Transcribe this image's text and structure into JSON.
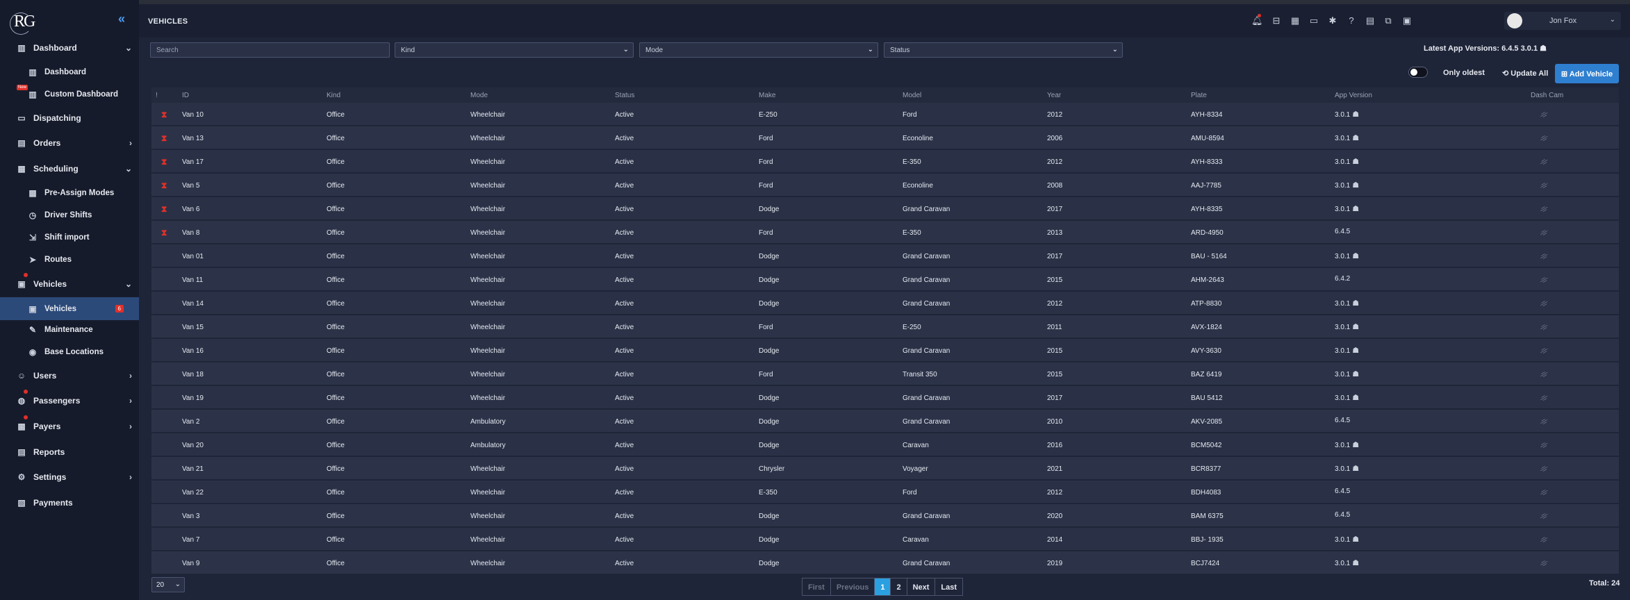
{
  "header": {
    "title": "VEHICLES",
    "user_name": "Jon Fox"
  },
  "sidebar": {
    "logo": "RG",
    "items": [
      {
        "label": "Dashboard"
      },
      {
        "label": "Dashboard"
      },
      {
        "label": "Custom Dashboard",
        "tag": "New"
      },
      {
        "label": "Dispatching"
      },
      {
        "label": "Orders"
      },
      {
        "label": "Scheduling"
      },
      {
        "label": "Pre-Assign Modes"
      },
      {
        "label": "Driver Shifts"
      },
      {
        "label": "Shift import"
      },
      {
        "label": "Routes"
      },
      {
        "label": "Vehicles"
      },
      {
        "label": "Vehicles",
        "badge": "6"
      },
      {
        "label": "Maintenance"
      },
      {
        "label": "Base Locations"
      },
      {
        "label": "Users"
      },
      {
        "label": "Passengers"
      },
      {
        "label": "Payers"
      },
      {
        "label": "Reports"
      },
      {
        "label": "Settings"
      },
      {
        "label": "Payments"
      }
    ]
  },
  "filters": {
    "search_placeholder": "Search",
    "kind": "Kind",
    "mode": "Mode",
    "status": "Status"
  },
  "latest_versions": {
    "label": "Latest App Versions: 6.4.5",
    "android": "3.0.1"
  },
  "controls": {
    "only_oldest": "Only oldest",
    "update_all": "Update All",
    "add_vehicle": "Add Vehicle"
  },
  "table": {
    "columns": [
      "!",
      "ID",
      "Kind",
      "Mode",
      "Status",
      "Make",
      "Model",
      "Year",
      "Plate",
      "App Version",
      "Dash Cam"
    ],
    "rows": [
      {
        "warn": true,
        "id": "Van 10",
        "kind": "Office",
        "mode": "Wheelchair",
        "status": "Active",
        "make": "E-250",
        "model": "Ford",
        "year": "2012",
        "plate": "AYH-8334",
        "version": "3.0.1",
        "os": "android"
      },
      {
        "warn": true,
        "id": "Van 13",
        "kind": "Office",
        "mode": "Wheelchair",
        "status": "Active",
        "make": "Ford",
        "model": "Econoline",
        "year": "2006",
        "plate": "AMU-8594",
        "version": "3.0.1",
        "os": "android"
      },
      {
        "warn": true,
        "id": "Van 17",
        "kind": "Office",
        "mode": "Wheelchair",
        "status": "Active",
        "make": "Ford",
        "model": "E-350",
        "year": "2012",
        "plate": "AYH-8333",
        "version": "3.0.1",
        "os": "android"
      },
      {
        "warn": true,
        "id": "Van 5",
        "kind": "Office",
        "mode": "Wheelchair",
        "status": "Active",
        "make": "Ford",
        "model": "Econoline",
        "year": "2008",
        "plate": "AAJ-7785",
        "version": "3.0.1",
        "os": "android"
      },
      {
        "warn": true,
        "id": "Van 6",
        "kind": "Office",
        "mode": "Wheelchair",
        "status": "Active",
        "make": "Dodge",
        "model": "Grand Caravan",
        "year": "2017",
        "plate": "AYH-8335",
        "version": "3.0.1",
        "os": "android"
      },
      {
        "warn": true,
        "id": "Van 8",
        "kind": "Office",
        "mode": "Wheelchair",
        "status": "Active",
        "make": "Ford",
        "model": "E-350",
        "year": "2013",
        "plate": "ARD-4950",
        "version": "6.4.5",
        "os": "apple"
      },
      {
        "warn": false,
        "id": "Van 01",
        "kind": "Office",
        "mode": "Wheelchair",
        "status": "Active",
        "make": "Dodge",
        "model": "Grand Caravan",
        "year": "2017",
        "plate": "BAU - 5164",
        "version": "3.0.1",
        "os": "android"
      },
      {
        "warn": false,
        "id": "Van 11",
        "kind": "Office",
        "mode": "Wheelchair",
        "status": "Active",
        "make": "Dodge",
        "model": "Grand Caravan",
        "year": "2015",
        "plate": "AHM-2643",
        "version": "6.4.2",
        "os": "apple"
      },
      {
        "warn": false,
        "id": "Van 14",
        "kind": "Office",
        "mode": "Wheelchair",
        "status": "Active",
        "make": "Dodge",
        "model": "Grand Caravan",
        "year": "2012",
        "plate": "ATP-8830",
        "version": "3.0.1",
        "os": "android"
      },
      {
        "warn": false,
        "id": "Van 15",
        "kind": "Office",
        "mode": "Wheelchair",
        "status": "Active",
        "make": "Ford",
        "model": "E-250",
        "year": "2011",
        "plate": "AVX-1824",
        "version": "3.0.1",
        "os": "android"
      },
      {
        "warn": false,
        "id": "Van 16",
        "kind": "Office",
        "mode": "Wheelchair",
        "status": "Active",
        "make": "Dodge",
        "model": "Grand Caravan",
        "year": "2015",
        "plate": "AVY-3630",
        "version": "3.0.1",
        "os": "android"
      },
      {
        "warn": false,
        "id": "Van 18",
        "kind": "Office",
        "mode": "Wheelchair",
        "status": "Active",
        "make": "Ford",
        "model": "Transit 350",
        "year": "2015",
        "plate": "BAZ 6419",
        "version": "3.0.1",
        "os": "android"
      },
      {
        "warn": false,
        "id": "Van 19",
        "kind": "Office",
        "mode": "Wheelchair",
        "status": "Active",
        "make": "Dodge",
        "model": "Grand Caravan",
        "year": "2017",
        "plate": "BAU 5412",
        "version": "3.0.1",
        "os": "android"
      },
      {
        "warn": false,
        "id": "Van 2",
        "kind": "Office",
        "mode": "Ambulatory",
        "status": "Active",
        "make": "Dodge",
        "model": "Grand Caravan",
        "year": "2010",
        "plate": "AKV-2085",
        "version": "6.4.5",
        "os": "apple"
      },
      {
        "warn": false,
        "id": "Van 20",
        "kind": "Office",
        "mode": "Ambulatory",
        "status": "Active",
        "make": "Dodge",
        "model": "Caravan",
        "year": "2016",
        "plate": "BCM5042",
        "version": "3.0.1",
        "os": "android"
      },
      {
        "warn": false,
        "id": "Van 21",
        "kind": "Office",
        "mode": "Wheelchair",
        "status": "Active",
        "make": "Chrysler",
        "model": "Voyager",
        "year": "2021",
        "plate": "BCR8377",
        "version": "3.0.1",
        "os": "android"
      },
      {
        "warn": false,
        "id": "Van 22",
        "kind": "Office",
        "mode": "Wheelchair",
        "status": "Active",
        "make": "E-350",
        "model": "Ford",
        "year": "2012",
        "plate": "BDH4083",
        "version": "6.4.5",
        "os": ""
      },
      {
        "warn": false,
        "id": "Van 3",
        "kind": "Office",
        "mode": "Wheelchair",
        "status": "Active",
        "make": "Dodge",
        "model": "Grand Caravan",
        "year": "2020",
        "plate": "BAM 6375",
        "version": "6.4.5",
        "os": "apple"
      },
      {
        "warn": false,
        "id": "Van 7",
        "kind": "Office",
        "mode": "Wheelchair",
        "status": "Active",
        "make": "Dodge",
        "model": "Caravan",
        "year": "2014",
        "plate": "BBJ- 1935",
        "version": "3.0.1",
        "os": "android"
      },
      {
        "warn": false,
        "id": "Van 9",
        "kind": "Office",
        "mode": "Wheelchair",
        "status": "Active",
        "make": "Dodge",
        "model": "Grand Caravan",
        "year": "2019",
        "plate": "BCJ7424",
        "version": "3.0.1",
        "os": "android"
      }
    ]
  },
  "pagination": {
    "per_page": "20",
    "first": "First",
    "previous": "Previous",
    "pages": [
      "1",
      "2"
    ],
    "next": "Next",
    "last": "Last",
    "total": "Total: 24"
  },
  "colors": {
    "accent": "#2f7fd0",
    "active_page": "#2aa0e0",
    "alert": "#e0302a",
    "background": "#1f2538",
    "sidebar": "#161b2b"
  }
}
